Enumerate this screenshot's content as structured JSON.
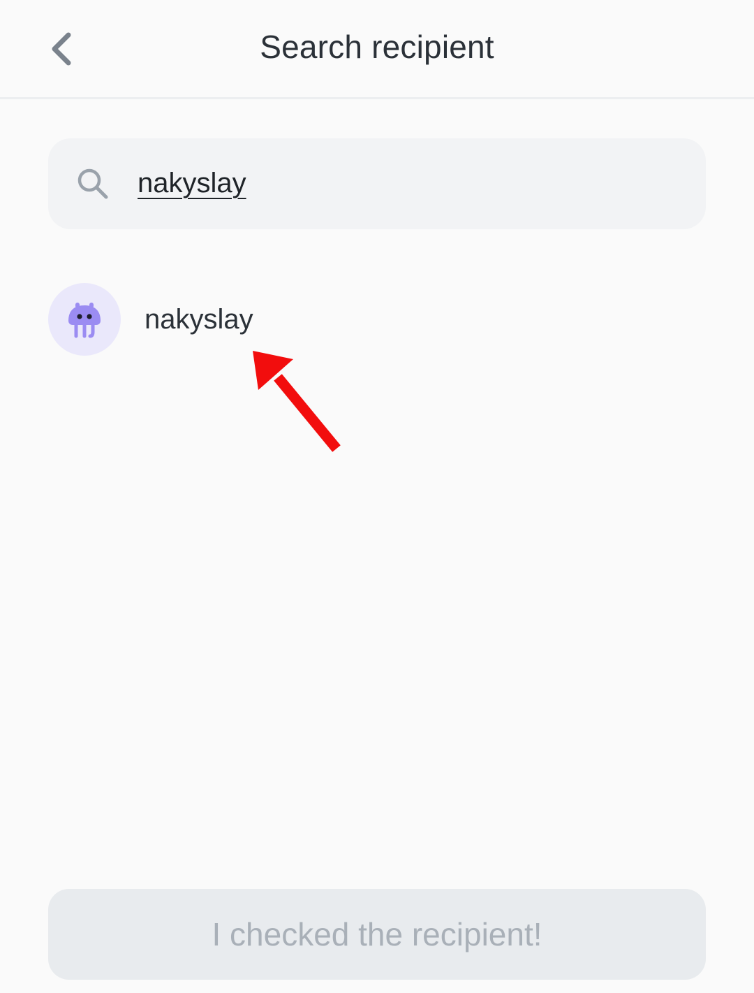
{
  "header": {
    "title": "Search recipient",
    "back_icon": "chevron-left-icon"
  },
  "search": {
    "icon": "search-icon",
    "value": "nakyslay"
  },
  "results": [
    {
      "name": "nakyslay",
      "avatar_icon": "jellyfish-avatar-icon",
      "avatar_bg": "#eae8fb",
      "avatar_color": "#9b8cf2"
    }
  ],
  "annotation": {
    "icon": "red-arrow-icon",
    "color": "#f20d0d"
  },
  "footer": {
    "confirm_label": "I checked the recipient!",
    "confirm_enabled": false
  },
  "colors": {
    "background": "#fafafa",
    "search_bg": "#f2f3f5",
    "button_disabled_bg": "#e8ebee",
    "button_disabled_text": "#a9b0b8",
    "text_primary": "#2b3138"
  }
}
